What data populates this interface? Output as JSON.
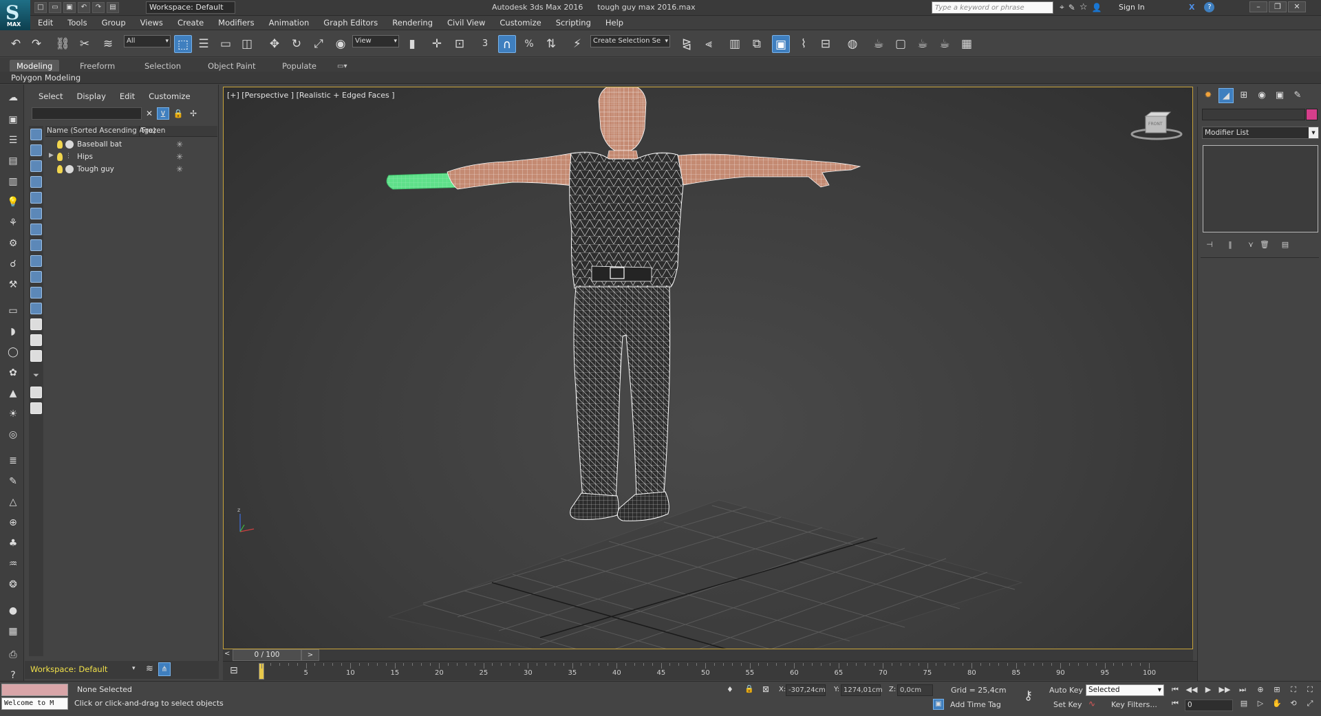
{
  "titlebar": {
    "logo": "MAX",
    "workspace": "Workspace: Default",
    "title": "Autodesk 3ds Max 2016      tough guy max 2016.max",
    "search_placeholder": "Type a keyword or phrase",
    "signin": "Sign In"
  },
  "menu": [
    "Edit",
    "Tools",
    "Group",
    "Views",
    "Create",
    "Modifiers",
    "Animation",
    "Graph Editors",
    "Rendering",
    "Civil View",
    "Customize",
    "Scripting",
    "Help"
  ],
  "toolbar": {
    "filter": "All",
    "refcoord": "View",
    "selection_set": "Create Selection Se"
  },
  "ribbon": {
    "tabs": [
      "Modeling",
      "Freeform",
      "Selection",
      "Object Paint",
      "Populate"
    ],
    "active": "Modeling",
    "panel": "Polygon Modeling"
  },
  "explorer": {
    "menu": [
      "Select",
      "Display",
      "Edit",
      "Customize"
    ],
    "col_name": "Name (Sorted Ascending Age)",
    "col_frozen": "Frozen",
    "rows": [
      {
        "name": "Baseball bat"
      },
      {
        "name": "Hips"
      },
      {
        "name": "Tough guy"
      }
    ],
    "workspace": "Workspace: Default"
  },
  "viewport": {
    "label": "[+] [Perspective ] [Realistic + Edged Faces ]",
    "cube_label": "FRONT"
  },
  "cmdpanel": {
    "modifier_list": "Modifier List"
  },
  "timeslider": {
    "position": "0 / 100",
    "ticks": [
      "5",
      "10",
      "15",
      "20",
      "25",
      "30",
      "35",
      "40",
      "45",
      "50",
      "55",
      "60",
      "65",
      "70",
      "75",
      "80",
      "85",
      "90",
      "95",
      "100"
    ]
  },
  "status": {
    "maxscript": "Welcome to M",
    "selection": "None Selected",
    "prompt": "Click or click-and-drag to select objects",
    "x_label": "X:",
    "x": "-307,24cm",
    "y_label": "Y:",
    "y": "1274,01cm",
    "z_label": "Z:",
    "z": "0,0cm",
    "grid": "Grid = 25,4cm",
    "add_time_tag": "Add Time Tag",
    "auto_key": "Auto Key",
    "set_key": "Set Key",
    "key_set": "Selected",
    "key_filters": "Key Filters...",
    "frame": "0"
  },
  "colors": {
    "viewport_border": "#c9a43a",
    "selection_green": "#5fe08a",
    "wire": "#ffffff",
    "skin": "#c48a72",
    "object_color": "#d63e8b"
  }
}
